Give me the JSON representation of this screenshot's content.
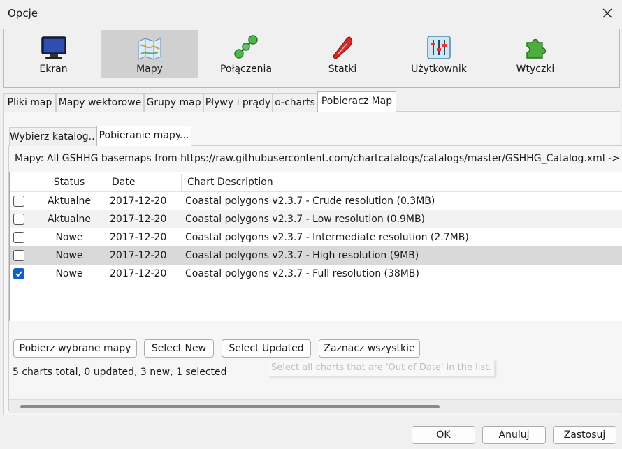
{
  "window": {
    "title": "Opcje"
  },
  "categories": [
    {
      "label": "Ekran",
      "icon": "monitor-icon"
    },
    {
      "label": "Mapy",
      "icon": "map-icon",
      "active": true
    },
    {
      "label": "Połączenia",
      "icon": "connections-icon"
    },
    {
      "label": "Statki",
      "icon": "ship-icon"
    },
    {
      "label": "Użytkownik",
      "icon": "user-settings-icon"
    },
    {
      "label": "Wtyczki",
      "icon": "plugin-icon"
    }
  ],
  "tabs": [
    {
      "label": "Pliki map"
    },
    {
      "label": "Mapy wektorowe"
    },
    {
      "label": "Grupy map"
    },
    {
      "label": "Pływy i prądy"
    },
    {
      "label": "o-charts"
    },
    {
      "label": "Pobieracz Map",
      "active": true
    }
  ],
  "subtabs": [
    {
      "label": "Wybierz katalog..."
    },
    {
      "label": "Pobieranie mapy...",
      "active": true
    }
  ],
  "source_line": "Mapy: All GSHHG basemaps from https://raw.githubusercontent.com/chartcatalogs/catalogs/master/GSHHG_Catalog.xml -> C:\\Us",
  "table": {
    "columns": [
      "Status",
      "Date",
      "Chart Description"
    ],
    "rows": [
      {
        "status": "Aktualne",
        "date": "2017-12-20",
        "desc": "Coastal polygons v2.3.7 - Crude resolution (0.3MB)",
        "checked": false
      },
      {
        "status": "Aktualne",
        "date": "2017-12-20",
        "desc": "Coastal polygons v2.3.7 - Low resolution (0.9MB)",
        "checked": false
      },
      {
        "status": "Nowe",
        "date": "2017-12-20",
        "desc": "Coastal polygons v2.3.7 - Intermediate resolution (2.7MB)",
        "checked": false
      },
      {
        "status": "Nowe",
        "date": "2017-12-20",
        "desc": "Coastal polygons v2.3.7 - High resolution (9MB)",
        "checked": false
      },
      {
        "status": "Nowe",
        "date": "2017-12-20",
        "desc": "Coastal polygons v2.3.7 - Full resolution (38MB)",
        "checked": true
      }
    ]
  },
  "actions": {
    "download": "Pobierz wybrane mapy",
    "select_new": "Select New",
    "select_updated": "Select Updated",
    "select_all": "Zaznacz wszystkie"
  },
  "summary": "5 charts total, 0 updated, 3 new, 1 selected",
  "tooltip": "Select all charts that are 'Out of Date' in the list.",
  "dialog": {
    "ok": "OK",
    "cancel": "Anuluj",
    "apply": "Zastosuj"
  },
  "colors": {
    "accent": "#0f5fc4",
    "selected_row": "#d9d9d9",
    "active_category": "#d0d0d0"
  }
}
